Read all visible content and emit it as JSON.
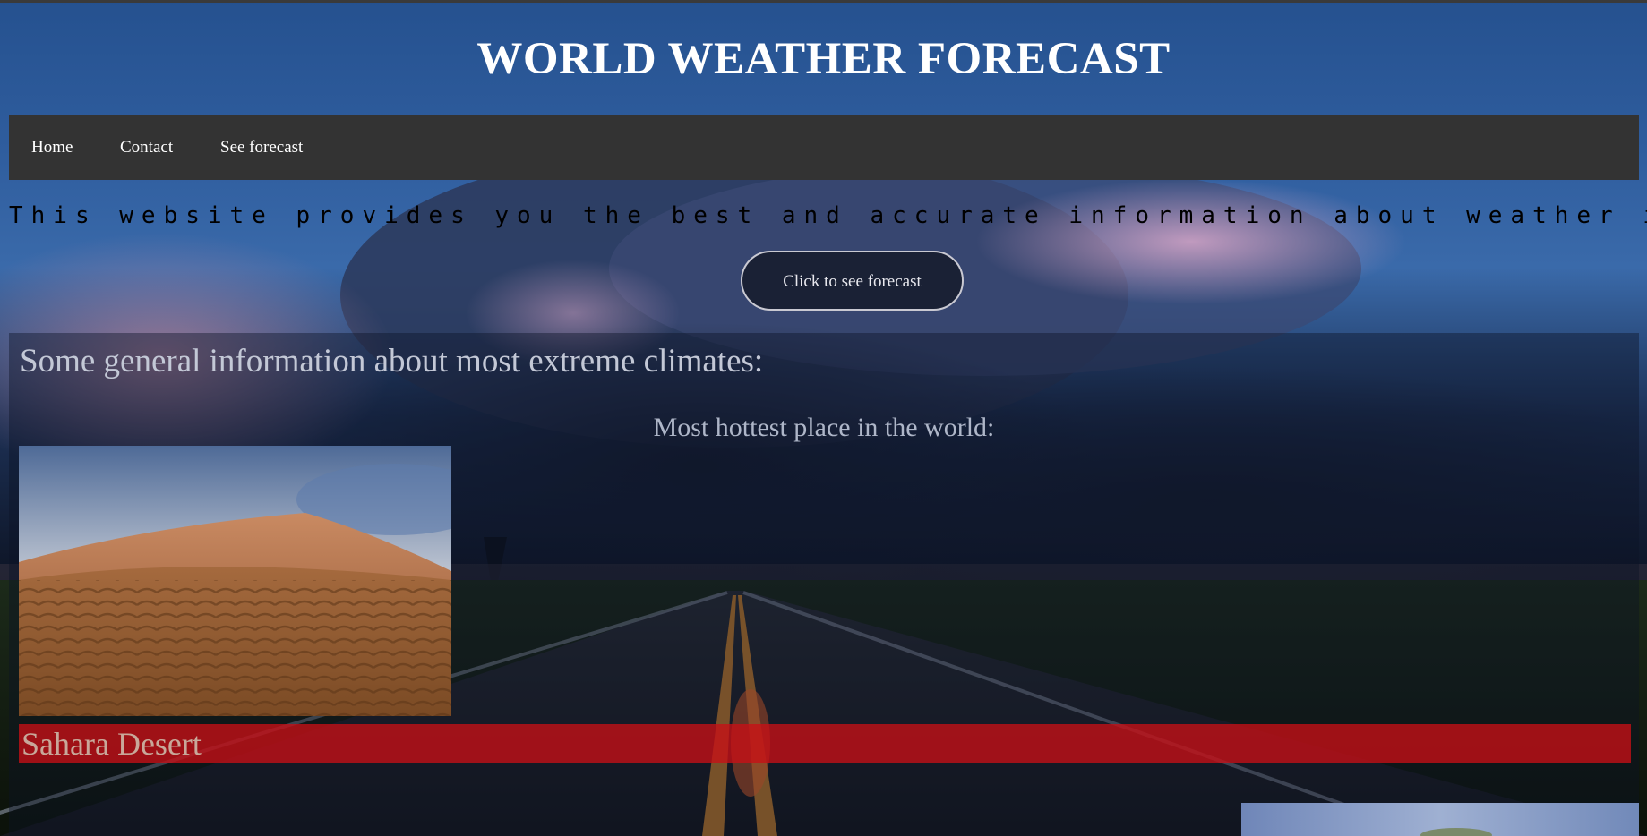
{
  "header": {
    "title": "WORLD WEATHER FORECAST"
  },
  "nav": {
    "items": [
      {
        "label": "Home"
      },
      {
        "label": "Contact"
      },
      {
        "label": "See forecast"
      }
    ]
  },
  "intro": {
    "text": "This website provides you the best and accurate information about weather in your area..."
  },
  "cta": {
    "label": "Click to see forecast"
  },
  "extremes": {
    "heading": "Some general information about most extreme climates:",
    "hottest": {
      "subheading": "Most hottest place in the world:",
      "place_name": "Sahara Desert"
    }
  },
  "colors": {
    "navbar_bg": "#333333",
    "place_bar": "#c81016",
    "title_text": "#ffffff"
  }
}
